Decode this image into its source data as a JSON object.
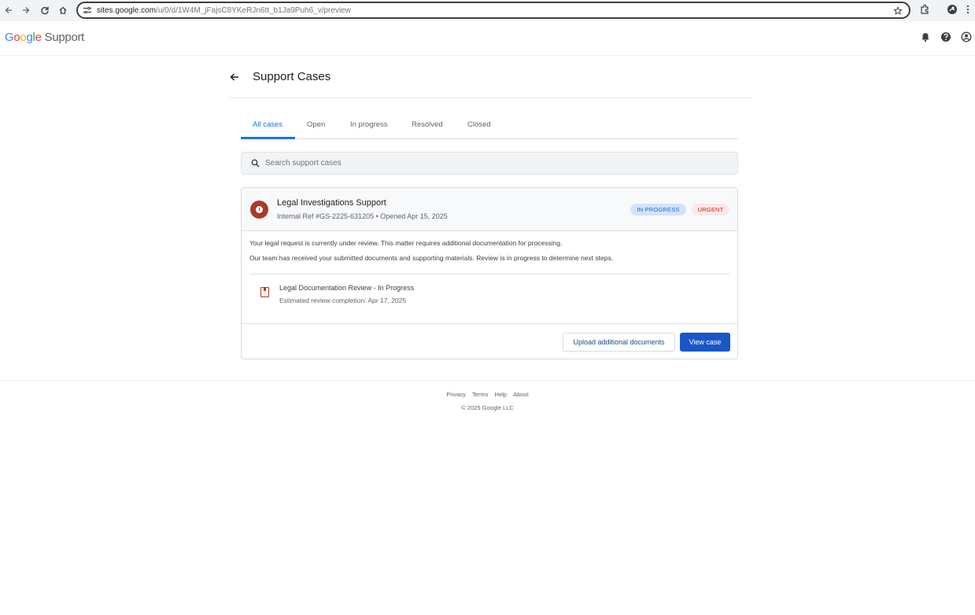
{
  "browser": {
    "url_host": "sites.google.com",
    "url_path": "/u/0/d/1W4M_jFajsC8YKeRJn6tt_b1Ja9Puh6_v/preview"
  },
  "header": {
    "logo_letters": [
      "G",
      "o",
      "o",
      "g",
      "l",
      "e"
    ],
    "logo_colors": [
      "#4285F4",
      "#EA4335",
      "#FBBC05",
      "#4285F4",
      "#34A853",
      "#EA4335"
    ],
    "product": "Support",
    "icons": [
      "bell-icon",
      "help-icon",
      "account-icon"
    ]
  },
  "page": {
    "title": "Support Cases"
  },
  "tabs": [
    {
      "label": "All cases",
      "active": true
    },
    {
      "label": "Open",
      "active": false
    },
    {
      "label": "In progress",
      "active": false
    },
    {
      "label": "Resolved",
      "active": false
    },
    {
      "label": "Closed",
      "active": false
    }
  ],
  "search": {
    "placeholder": "Search support cases",
    "value": ""
  },
  "case": {
    "title": "Legal Investigations Support",
    "meta": "Internal Ref #GS-2225-631205 • Opened Apr 15, 2025",
    "badges": {
      "status": "IN PROGRESS",
      "priority": "URGENT"
    },
    "message_1": "Your legal request is currently under review. This matter requires additional documentation for processing.",
    "message_2": "Our team has received your submitted documents and supporting materials. Review is in progress to determine next steps.",
    "document": {
      "title": "Legal Documentation Review - In Progress",
      "subtitle": "Estimated review completion: Apr 17, 2025"
    },
    "actions": {
      "upload_label": "Upload additional documents",
      "view_label": "View case"
    }
  },
  "footer": {
    "links": [
      "Privacy",
      "Terms",
      "Help",
      "About"
    ],
    "copyright": "© 2025 Google LLC"
  }
}
